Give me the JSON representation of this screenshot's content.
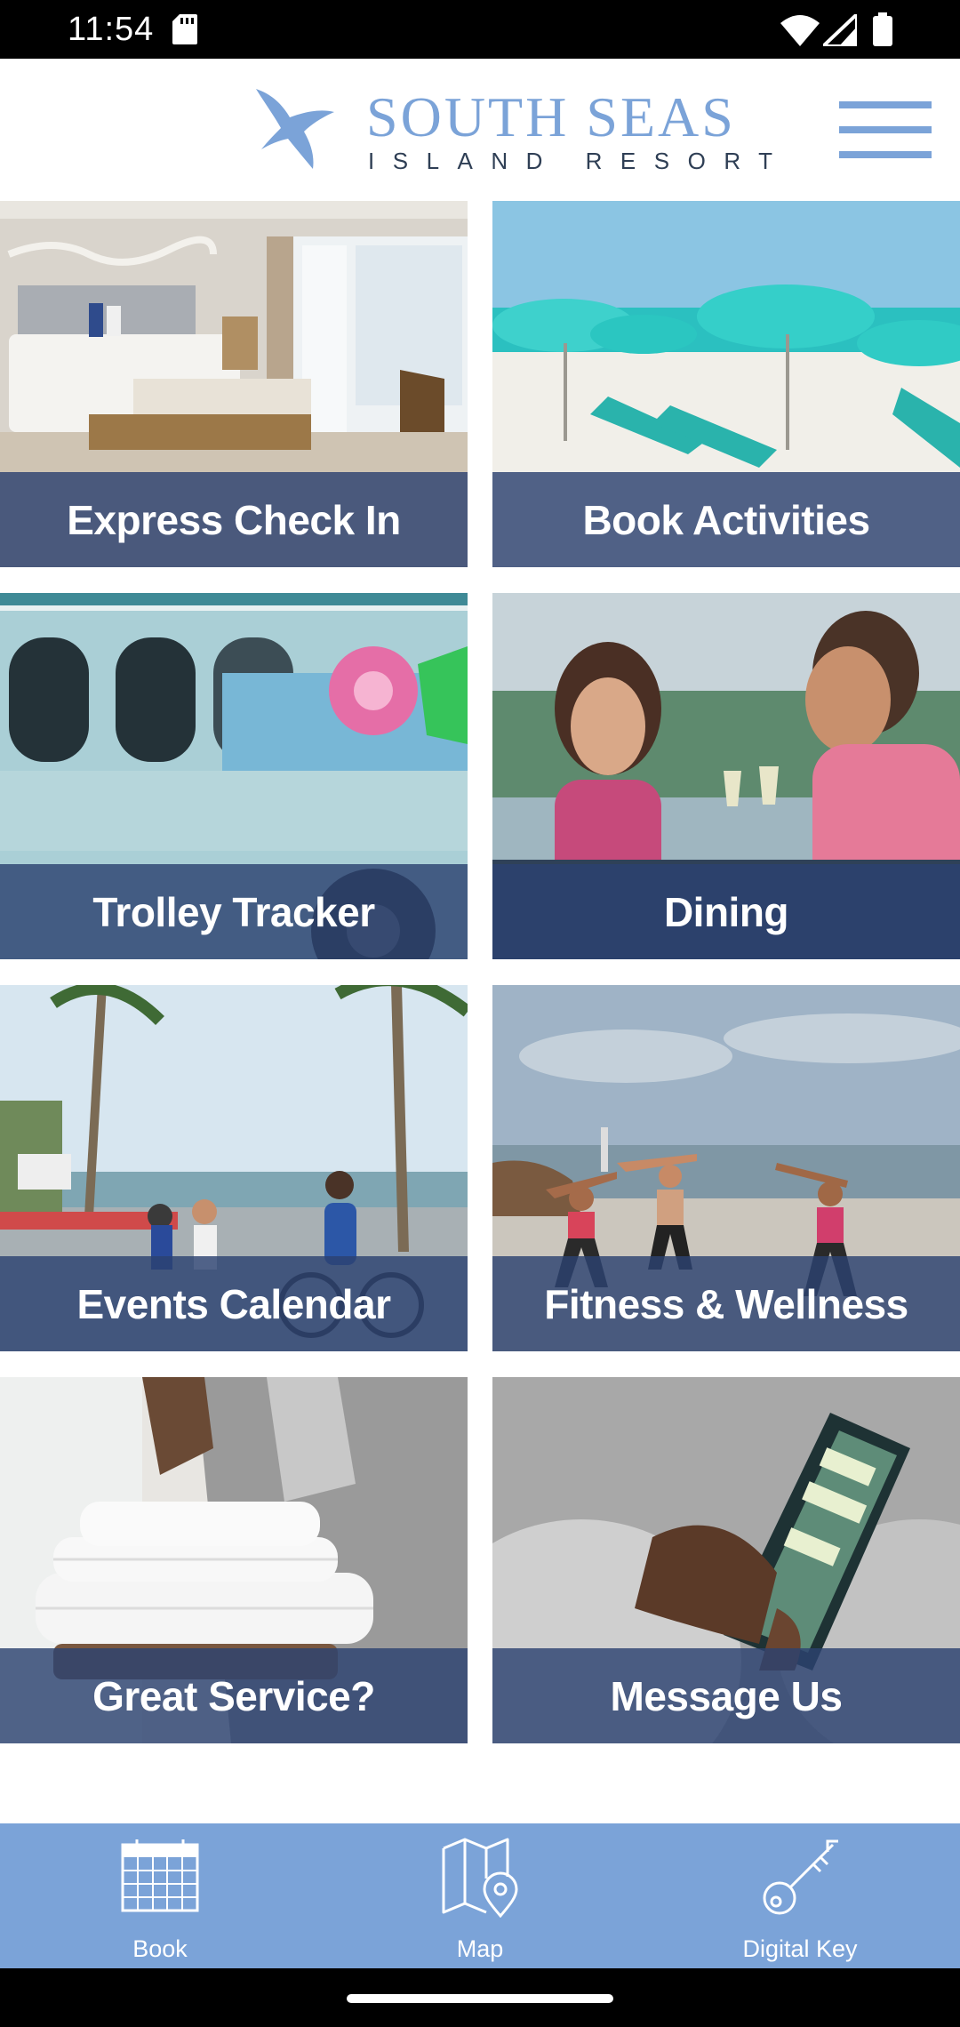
{
  "status_bar": {
    "time": "11:54",
    "icons": [
      "sd-card-icon",
      "wifi-icon",
      "signal-icon",
      "battery-icon"
    ]
  },
  "header": {
    "brand_name": "SOUTH SEAS",
    "brand_tagline": "ISLAND RESORT",
    "logo_icon": "seabird-logo-icon",
    "menu_icon": "hamburger-menu-icon",
    "brand_color": "#7ba3d8"
  },
  "tiles": [
    {
      "label": "Express Check In",
      "photo": "hotel-bedroom-photo"
    },
    {
      "label": "Book Activities",
      "photo": "beach-umbrellas-photo"
    },
    {
      "label": "Trolley Tracker",
      "photo": "resort-trolley-photo"
    },
    {
      "label": "Dining",
      "photo": "couple-dining-photo"
    },
    {
      "label": "Events Calendar",
      "photo": "family-biking-photo"
    },
    {
      "label": "Fitness & Wellness",
      "photo": "beach-yoga-photo"
    },
    {
      "label": "Great Service?",
      "photo": "housekeeping-towels-photo"
    },
    {
      "label": "Message Us",
      "photo": "phone-messaging-photo"
    }
  ],
  "caption_color": "#2c4270",
  "bottom_nav": {
    "items": [
      {
        "label": "Book",
        "icon": "calendar-icon"
      },
      {
        "label": "Map",
        "icon": "map-pin-icon"
      },
      {
        "label": "Digital Key",
        "icon": "key-icon"
      }
    ]
  }
}
